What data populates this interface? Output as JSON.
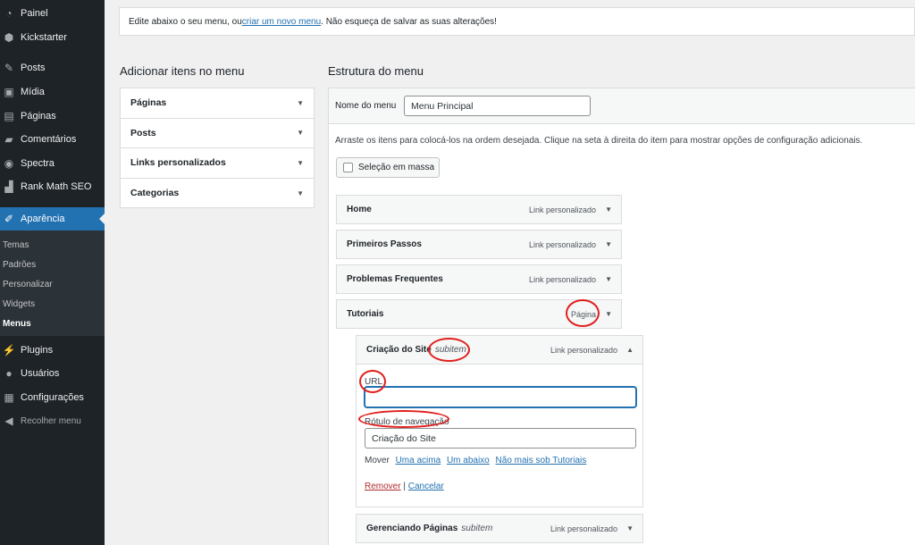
{
  "sidebar": {
    "items": [
      {
        "label": "Painel",
        "icon": "dashboard-icon"
      },
      {
        "label": "Kickstarter",
        "icon": "kickstarter-icon"
      },
      {
        "label": "Posts",
        "icon": "pin-icon"
      },
      {
        "label": "Mídia",
        "icon": "media-icon"
      },
      {
        "label": "Páginas",
        "icon": "pages-icon"
      },
      {
        "label": "Comentários",
        "icon": "comment-icon"
      },
      {
        "label": "Spectra",
        "icon": "spectra-icon"
      },
      {
        "label": "Rank Math SEO",
        "icon": "chart-icon"
      },
      {
        "label": "Aparência",
        "icon": "brush-icon"
      },
      {
        "label": "Plugins",
        "icon": "plugin-icon"
      },
      {
        "label": "Usuários",
        "icon": "user-icon"
      },
      {
        "label": "Configurações",
        "icon": "settings-icon"
      }
    ],
    "submenu": [
      "Temas",
      "Padrões",
      "Personalizar",
      "Widgets",
      "Menus"
    ],
    "collapse": "Recolher menu"
  },
  "notice": {
    "before": "Edite abaixo o seu menu, ou ",
    "link": "criar um novo menu",
    "after": ". Não esqueça de salvar as suas alterações!"
  },
  "left": {
    "title": "Adicionar itens no menu",
    "sections": [
      "Páginas",
      "Posts",
      "Links personalizados",
      "Categorias"
    ]
  },
  "structure": {
    "title": "Estrutura do menu",
    "name_label": "Nome do menu",
    "name_value": "Menu Principal",
    "hint": "Arraste os itens para colocá-los na ordem desejada. Clique na seta à direita do item para mostrar opções de configuração adicionais.",
    "bulk": "Seleção em massa",
    "items": [
      {
        "title": "Home",
        "type": "Link personalizado"
      },
      {
        "title": "Primeiros Passos",
        "type": "Link personalizado"
      },
      {
        "title": "Problemas Frequentes",
        "type": "Link personalizado"
      },
      {
        "title": "Tutoriais",
        "type": "Página"
      }
    ],
    "subitem_tag": "subitem",
    "open_item": {
      "title": "Criação do Site",
      "type": "Link personalizado",
      "url_label": "URL",
      "url_value": "",
      "nav_label": "Rótulo de navegação",
      "nav_value": "Criação do Site",
      "move_label": "Mover",
      "move_links": [
        "Uma acima",
        "Um abaixo",
        "Não mais sob Tutoriais"
      ],
      "remove": "Remover",
      "separator": "|",
      "cancel": "Cancelar"
    },
    "next_item": {
      "title": "Gerenciando Páginas",
      "type": "Link personalizado"
    }
  },
  "colors": {
    "sidebar": "#1d2327",
    "accent": "#2271b1",
    "annotation": "#e0201e"
  }
}
